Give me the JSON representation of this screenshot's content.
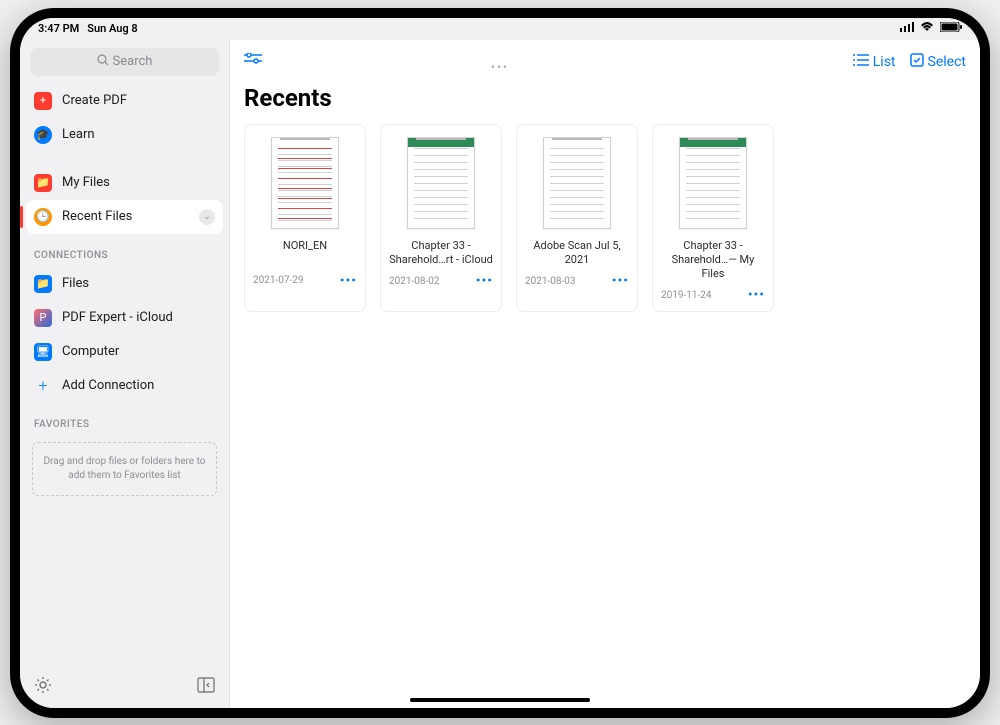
{
  "statusbar": {
    "time": "3:47 PM",
    "date": "Sun Aug 8"
  },
  "sidebar": {
    "search_placeholder": "Search",
    "items_primary": [
      {
        "label": "Create PDF",
        "icon": "plus-icon",
        "icon_label": "+"
      },
      {
        "label": "Learn",
        "icon": "graduation-icon",
        "icon_label": "🎓"
      }
    ],
    "items_files": [
      {
        "label": "My Files",
        "icon": "folder-icon",
        "icon_label": "📁"
      },
      {
        "label": "Recent Files",
        "icon": "clock-icon",
        "icon_label": "🕒"
      }
    ],
    "section_connections": "CONNECTIONS",
    "items_connections": [
      {
        "label": "Files",
        "icon": "folder-icon",
        "icon_label": "📁"
      },
      {
        "label": "PDF Expert - iCloud",
        "icon": "pdfexpert-icon",
        "icon_label": "P"
      },
      {
        "label": "Computer",
        "icon": "computer-icon",
        "icon_label": "🖥"
      },
      {
        "label": "Add Connection",
        "icon": "plus-icon",
        "icon_label": "+"
      }
    ],
    "section_favorites": "FAVORITES",
    "favorites_hint": "Drag and drop files or folders here to add them to Favorites list"
  },
  "topbar": {
    "list_label": "List",
    "select_label": "Select"
  },
  "main": {
    "title": "Recents",
    "files": [
      {
        "title": "NORI_EN",
        "date": "2021-07-29",
        "style": "redmark"
      },
      {
        "title": "Chapter 33 - Sharehold…rt - iCloud",
        "date": "2021-08-02",
        "style": "greenhead"
      },
      {
        "title": "Adobe Scan Jul 5, 2021",
        "date": "2021-08-03",
        "style": "plain"
      },
      {
        "title": "Chapter 33 - Sharehold…— My Files",
        "date": "2019-11-24",
        "style": "greenhead"
      }
    ]
  }
}
